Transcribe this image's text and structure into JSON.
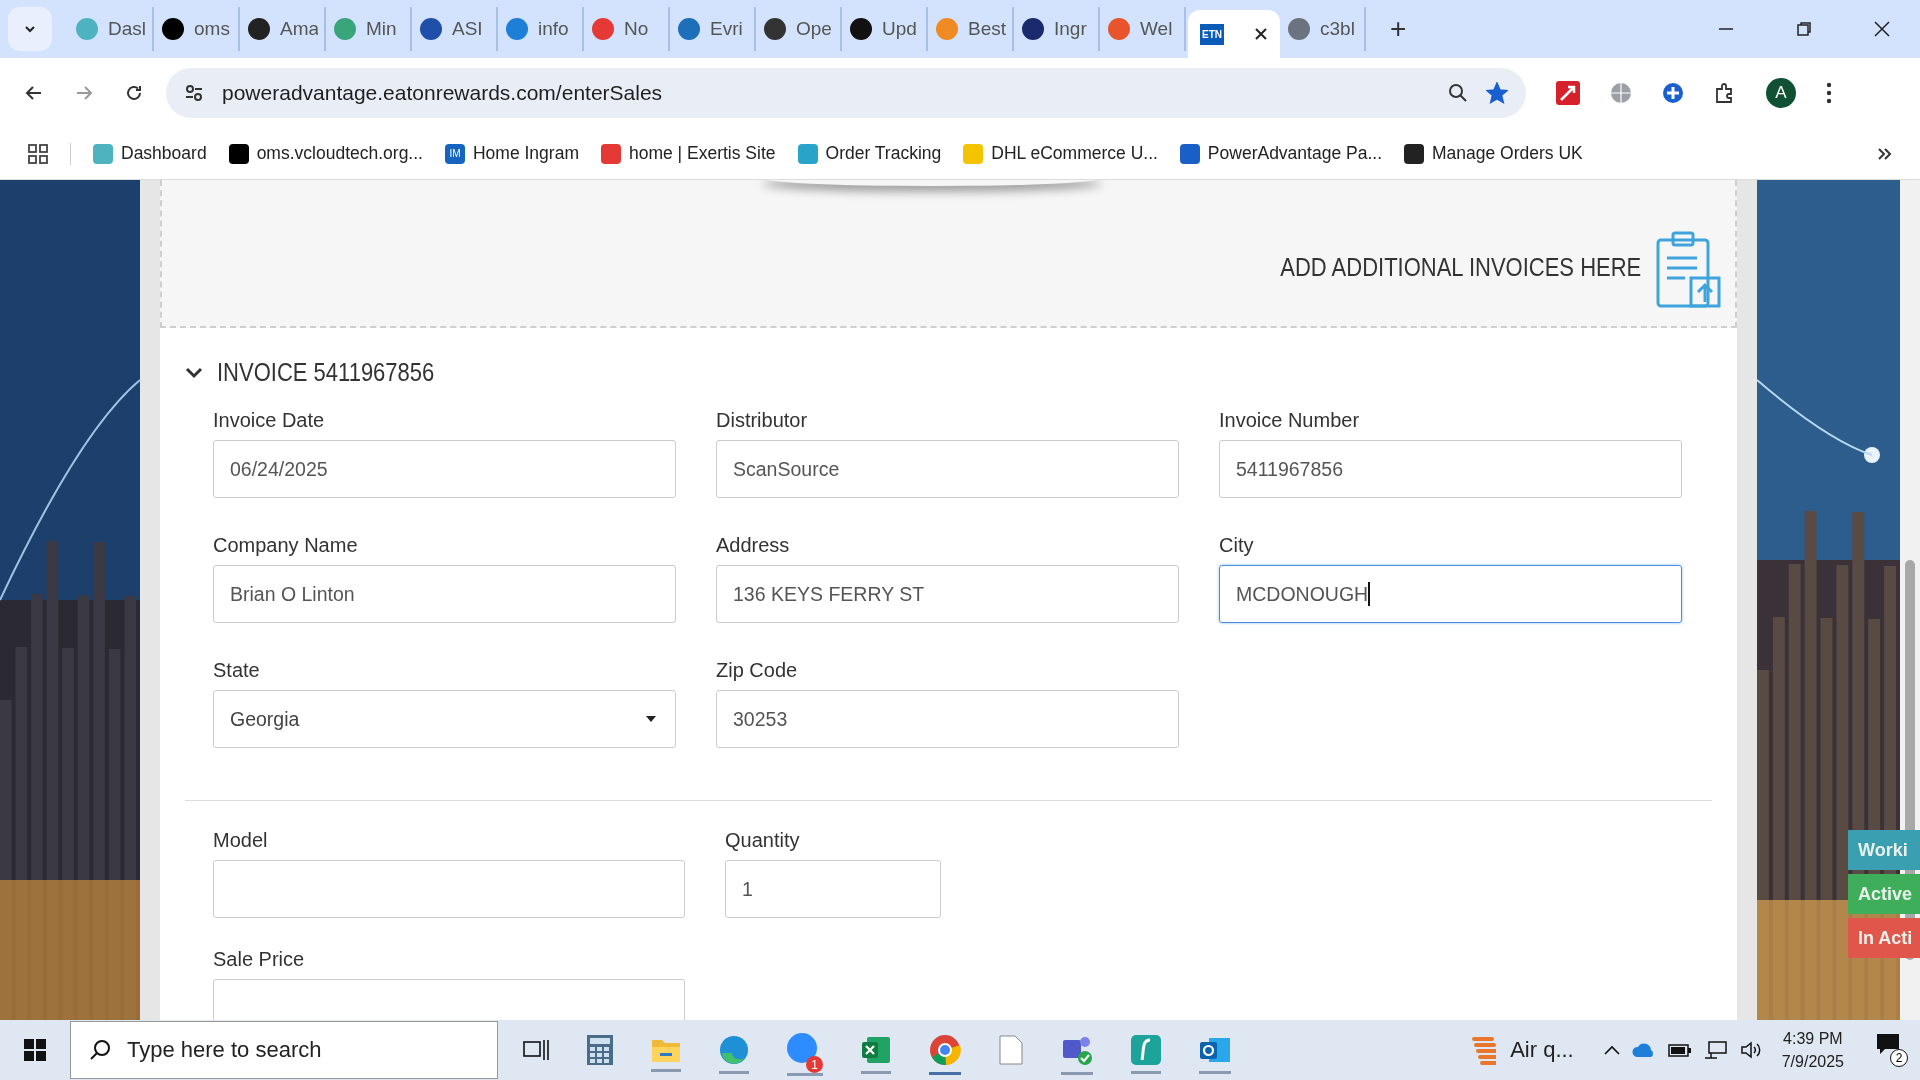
{
  "browser": {
    "tabs": [
      {
        "title": "Dasl",
        "selected": false,
        "color": "#4fb3bf"
      },
      {
        "title": "oms",
        "selected": false,
        "color": "#000000"
      },
      {
        "title": "Ama",
        "selected": false,
        "color": "#222222"
      },
      {
        "title": "Min",
        "selected": false,
        "color": "#3aa57a"
      },
      {
        "title": "ASI",
        "selected": false,
        "color": "#1f4fa8"
      },
      {
        "title": "info",
        "selected": false,
        "color": "#1e7fd8"
      },
      {
        "title": "No",
        "selected": false,
        "color": "#e53935"
      },
      {
        "title": "Evri",
        "selected": false,
        "color": "#1c6fb8"
      },
      {
        "title": "Ope",
        "selected": false,
        "color": "#333333"
      },
      {
        "title": "Upd",
        "selected": false,
        "color": "#111111"
      },
      {
        "title": "Best",
        "selected": false,
        "color": "#f08a24"
      },
      {
        "title": "Ingr",
        "selected": false,
        "color": "#1a2a6c"
      },
      {
        "title": "Wel",
        "selected": false,
        "color": "#e8552d"
      },
      {
        "title": "ETN",
        "selected": true,
        "color": "#0a5cb8"
      },
      {
        "title": "c3bl",
        "selected": false,
        "color": "#6b7280"
      }
    ],
    "new_tab": "+",
    "url": "poweradvantage.eatonrewards.com/enterSales",
    "bookmarked": true,
    "profile": "A",
    "bookmarks": [
      {
        "label": "Dashboard",
        "color": "#4fb3bf"
      },
      {
        "label": "oms.vcloudtech.org...",
        "color": "#000000"
      },
      {
        "label": "Home Ingram",
        "color": "#1565c0"
      },
      {
        "label": "home | Exertis Site",
        "color": "#e53935"
      },
      {
        "label": "Order Tracking",
        "color": "#29a3c9"
      },
      {
        "label": "DHL eCommerce U...",
        "color": "#f5c400"
      },
      {
        "label": "PowerAdvantage Pa...",
        "color": "#1a5fc8"
      },
      {
        "label": "Manage Orders UK",
        "color": "#222222"
      }
    ],
    "bookmark_bank_icon_text": "IM"
  },
  "page": {
    "dropzone": {
      "text": "ADD ADDITIONAL INVOICES HERE"
    },
    "invoice": {
      "title": "INVOICE 5411967856",
      "expanded": true,
      "fields": [
        {
          "label": "Invoice Date",
          "value": "06/24/2025",
          "kind": "text",
          "focused": false
        },
        {
          "label": "Distributor",
          "value": "ScanSource",
          "kind": "text",
          "focused": false
        },
        {
          "label": "Invoice Number",
          "value": "5411967856",
          "kind": "text",
          "focused": false
        },
        {
          "label": "Company Name",
          "value": "Brian O Linton",
          "kind": "text",
          "focused": false
        },
        {
          "label": "Address",
          "value": "136 KEYS FERRY ST",
          "kind": "text",
          "focused": false
        },
        {
          "label": "City",
          "value": "MCDONOUGH",
          "kind": "text",
          "focused": true
        },
        {
          "label": "State",
          "value": "Georgia",
          "kind": "select",
          "focused": false
        },
        {
          "label": "Zip Code",
          "value": "30253",
          "kind": "text",
          "focused": false
        }
      ],
      "product": {
        "model": {
          "label": "Model"
        },
        "quantity": {
          "label": "Quantity",
          "value": "1"
        },
        "sale_price": {
          "label": "Sale Price"
        }
      }
    },
    "status_buttons": [
      {
        "label": "Worki",
        "color": "#3a9fb0"
      },
      {
        "label": "Active",
        "color": "#3fae5a"
      },
      {
        "label": "In Acti",
        "color": "#e0564a"
      }
    ]
  },
  "taskbar": {
    "search_placeholder": "Type here to search",
    "zoom_badge": "1",
    "weather": "Air q...",
    "time": "4:39 PM",
    "date": "7/9/2025",
    "notifications": "2"
  }
}
